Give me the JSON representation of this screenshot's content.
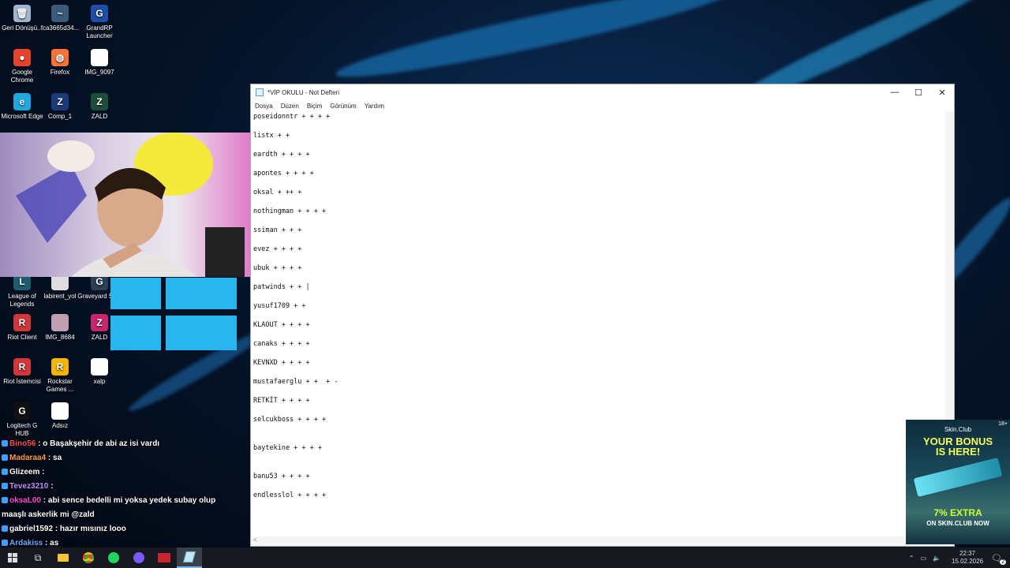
{
  "desktop_icons": [
    {
      "id": "recycle",
      "label": "Geri Dönüşü...",
      "icon": "recycle-bin-icon",
      "color": "#9fb6d0",
      "glyph": "🗑"
    },
    {
      "id": "fca",
      "label": "fca3665d34...",
      "icon": "file-icon",
      "color": "#3a5a7a",
      "glyph": "~"
    },
    {
      "id": "grandrp",
      "label": "GrandRP Launcher",
      "icon": "grandrp-icon",
      "color": "#1d4fa8",
      "glyph": "G"
    },
    {
      "id": "chrome",
      "label": "Google Chrome",
      "icon": "chrome-icon",
      "color": "#e4432d",
      "glyph": "●"
    },
    {
      "id": "firefox",
      "label": "Firefox",
      "icon": "firefox-icon",
      "color": "#ff7139",
      "glyph": "◍"
    },
    {
      "id": "img9097",
      "label": "IMG_9097",
      "icon": "image-file-icon",
      "color": "#ffffff",
      "glyph": ""
    },
    {
      "id": "edge",
      "label": "Microsoft Edge",
      "icon": "edge-icon",
      "color": "#1fa8e0",
      "glyph": "e"
    },
    {
      "id": "comp1",
      "label": "Comp_1",
      "icon": "comp-icon",
      "color": "#1a3a7a",
      "glyph": "Z"
    },
    {
      "id": "zald1",
      "label": "ZALD",
      "icon": "zald-icon",
      "color": "#1e4d3a",
      "glyph": "Z"
    },
    {
      "id": "lol",
      "label": "League of Legends",
      "icon": "league-icon",
      "color": "#1c5e6e",
      "glyph": "L"
    },
    {
      "id": "labirent",
      "label": "labirent_yol",
      "icon": "file-icon",
      "color": "#dddddd",
      "glyph": ""
    },
    {
      "id": "graveyard",
      "label": "Graveyard Shift",
      "icon": "game-icon",
      "color": "#2a3f5a",
      "glyph": "G"
    },
    {
      "id": "riot",
      "label": "Riot Client",
      "icon": "riot-icon",
      "color": "#d13639",
      "glyph": "R"
    },
    {
      "id": "img8684",
      "label": "IMG_8684",
      "icon": "image-file-icon",
      "color": "#c0a0b0",
      "glyph": ""
    },
    {
      "id": "zald2",
      "label": "ZALD",
      "icon": "zald-icon",
      "color": "#c8266c",
      "glyph": "Z"
    },
    {
      "id": "riotist",
      "label": "Riot İstemcisi",
      "icon": "riot-icon",
      "color": "#d13639",
      "glyph": "R"
    },
    {
      "id": "rockstar",
      "label": "Rockstar Games ...",
      "icon": "rockstar-icon",
      "color": "#f5b400",
      "glyph": "R"
    },
    {
      "id": "xalp",
      "label": "xalp",
      "icon": "file-icon",
      "color": "#ffffff",
      "glyph": ""
    },
    {
      "id": "logitech",
      "label": "Logitech G HUB",
      "icon": "logitech-icon",
      "color": "#111111",
      "glyph": "G"
    },
    {
      "id": "adsiz",
      "label": "Adsız",
      "icon": "file-icon",
      "color": "#ffffff",
      "glyph": ""
    }
  ],
  "notepad": {
    "title": "*VİP OKULU - Not Defteri",
    "menu": [
      "Dosya",
      "Düzen",
      "Biçim",
      "Görünüm",
      "Yardım"
    ],
    "lines": [
      "poseidonntr + + + +",
      "listx + +",
      "eardth + + + +",
      "apontes + + + +",
      "oksal + ++ +",
      "nothingman + + + +",
      "ssiman + + +",
      "evez + + + +",
      "ubuk + + + +",
      "patwinds + + |",
      "yusuf1709 + +",
      "KLAOUT + + + +",
      "canaks + + + +",
      "KEVNXD + + + +",
      "mustafaerglu + +  + -",
      "RETKİT + + + +",
      "selcukboss + + + +",
      "baytekine + + + +",
      "banu53 + + + +",
      "endlesslol + + + +"
    ],
    "hscroll_glyph": "<"
  },
  "chat": [
    {
      "user": "Bino56",
      "color": "#ff4d4d",
      "text": " : o Başakşehir de abi az isi vardı"
    },
    {
      "user": "Madaraa4",
      "color": "#ff9a3c",
      "text": " : sa"
    },
    {
      "user": "Glizeem",
      "color": "#ffffff",
      "text": " : "
    },
    {
      "user": "Tevez3210",
      "color": "#c48bff",
      "text": " : "
    },
    {
      "user": "oksaL00",
      "color": "#ff4dd2",
      "text": " : abi sence bedelli mi yoksa yedek subay olup"
    },
    {
      "user": "",
      "color": "#ffffff",
      "text": "maaşlı askerlik mi @zald"
    },
    {
      "user": "gabriel1592",
      "color": "#ffffff",
      "text": " : hazır mısınız looo"
    },
    {
      "user": "Ardakiss",
      "color": "#6fa8ff",
      "text": " : as"
    }
  ],
  "ad": {
    "age": "18+",
    "brand": "Skin.Club",
    "headline1": "YOUR BONUS",
    "headline2": "IS HERE!",
    "extra": "7% EXTRA",
    "cta": "ON SKIN.CLUB NOW"
  },
  "taskbar": {
    "time": "22:37",
    "date": "15.02.2026",
    "notifications": "2"
  }
}
